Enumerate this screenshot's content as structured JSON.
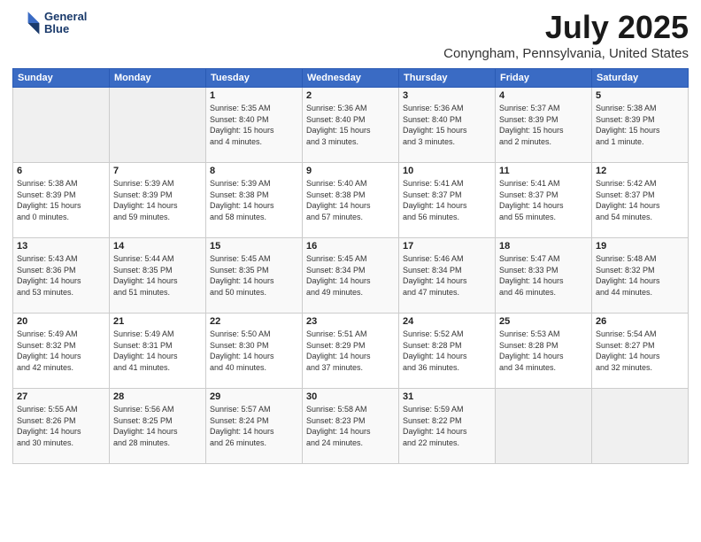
{
  "header": {
    "logo_line1": "General",
    "logo_line2": "Blue",
    "month": "July 2025",
    "location": "Conyngham, Pennsylvania, United States"
  },
  "weekdays": [
    "Sunday",
    "Monday",
    "Tuesday",
    "Wednesday",
    "Thursday",
    "Friday",
    "Saturday"
  ],
  "weeks": [
    [
      {
        "day": "",
        "info": ""
      },
      {
        "day": "",
        "info": ""
      },
      {
        "day": "1",
        "info": "Sunrise: 5:35 AM\nSunset: 8:40 PM\nDaylight: 15 hours\nand 4 minutes."
      },
      {
        "day": "2",
        "info": "Sunrise: 5:36 AM\nSunset: 8:40 PM\nDaylight: 15 hours\nand 3 minutes."
      },
      {
        "day": "3",
        "info": "Sunrise: 5:36 AM\nSunset: 8:40 PM\nDaylight: 15 hours\nand 3 minutes."
      },
      {
        "day": "4",
        "info": "Sunrise: 5:37 AM\nSunset: 8:39 PM\nDaylight: 15 hours\nand 2 minutes."
      },
      {
        "day": "5",
        "info": "Sunrise: 5:38 AM\nSunset: 8:39 PM\nDaylight: 15 hours\nand 1 minute."
      }
    ],
    [
      {
        "day": "6",
        "info": "Sunrise: 5:38 AM\nSunset: 8:39 PM\nDaylight: 15 hours\nand 0 minutes."
      },
      {
        "day": "7",
        "info": "Sunrise: 5:39 AM\nSunset: 8:39 PM\nDaylight: 14 hours\nand 59 minutes."
      },
      {
        "day": "8",
        "info": "Sunrise: 5:39 AM\nSunset: 8:38 PM\nDaylight: 14 hours\nand 58 minutes."
      },
      {
        "day": "9",
        "info": "Sunrise: 5:40 AM\nSunset: 8:38 PM\nDaylight: 14 hours\nand 57 minutes."
      },
      {
        "day": "10",
        "info": "Sunrise: 5:41 AM\nSunset: 8:37 PM\nDaylight: 14 hours\nand 56 minutes."
      },
      {
        "day": "11",
        "info": "Sunrise: 5:41 AM\nSunset: 8:37 PM\nDaylight: 14 hours\nand 55 minutes."
      },
      {
        "day": "12",
        "info": "Sunrise: 5:42 AM\nSunset: 8:37 PM\nDaylight: 14 hours\nand 54 minutes."
      }
    ],
    [
      {
        "day": "13",
        "info": "Sunrise: 5:43 AM\nSunset: 8:36 PM\nDaylight: 14 hours\nand 53 minutes."
      },
      {
        "day": "14",
        "info": "Sunrise: 5:44 AM\nSunset: 8:35 PM\nDaylight: 14 hours\nand 51 minutes."
      },
      {
        "day": "15",
        "info": "Sunrise: 5:45 AM\nSunset: 8:35 PM\nDaylight: 14 hours\nand 50 minutes."
      },
      {
        "day": "16",
        "info": "Sunrise: 5:45 AM\nSunset: 8:34 PM\nDaylight: 14 hours\nand 49 minutes."
      },
      {
        "day": "17",
        "info": "Sunrise: 5:46 AM\nSunset: 8:34 PM\nDaylight: 14 hours\nand 47 minutes."
      },
      {
        "day": "18",
        "info": "Sunrise: 5:47 AM\nSunset: 8:33 PM\nDaylight: 14 hours\nand 46 minutes."
      },
      {
        "day": "19",
        "info": "Sunrise: 5:48 AM\nSunset: 8:32 PM\nDaylight: 14 hours\nand 44 minutes."
      }
    ],
    [
      {
        "day": "20",
        "info": "Sunrise: 5:49 AM\nSunset: 8:32 PM\nDaylight: 14 hours\nand 42 minutes."
      },
      {
        "day": "21",
        "info": "Sunrise: 5:49 AM\nSunset: 8:31 PM\nDaylight: 14 hours\nand 41 minutes."
      },
      {
        "day": "22",
        "info": "Sunrise: 5:50 AM\nSunset: 8:30 PM\nDaylight: 14 hours\nand 40 minutes."
      },
      {
        "day": "23",
        "info": "Sunrise: 5:51 AM\nSunset: 8:29 PM\nDaylight: 14 hours\nand 37 minutes."
      },
      {
        "day": "24",
        "info": "Sunrise: 5:52 AM\nSunset: 8:28 PM\nDaylight: 14 hours\nand 36 minutes."
      },
      {
        "day": "25",
        "info": "Sunrise: 5:53 AM\nSunset: 8:28 PM\nDaylight: 14 hours\nand 34 minutes."
      },
      {
        "day": "26",
        "info": "Sunrise: 5:54 AM\nSunset: 8:27 PM\nDaylight: 14 hours\nand 32 minutes."
      }
    ],
    [
      {
        "day": "27",
        "info": "Sunrise: 5:55 AM\nSunset: 8:26 PM\nDaylight: 14 hours\nand 30 minutes."
      },
      {
        "day": "28",
        "info": "Sunrise: 5:56 AM\nSunset: 8:25 PM\nDaylight: 14 hours\nand 28 minutes."
      },
      {
        "day": "29",
        "info": "Sunrise: 5:57 AM\nSunset: 8:24 PM\nDaylight: 14 hours\nand 26 minutes."
      },
      {
        "day": "30",
        "info": "Sunrise: 5:58 AM\nSunset: 8:23 PM\nDaylight: 14 hours\nand 24 minutes."
      },
      {
        "day": "31",
        "info": "Sunrise: 5:59 AM\nSunset: 8:22 PM\nDaylight: 14 hours\nand 22 minutes."
      },
      {
        "day": "",
        "info": ""
      },
      {
        "day": "",
        "info": ""
      }
    ]
  ]
}
